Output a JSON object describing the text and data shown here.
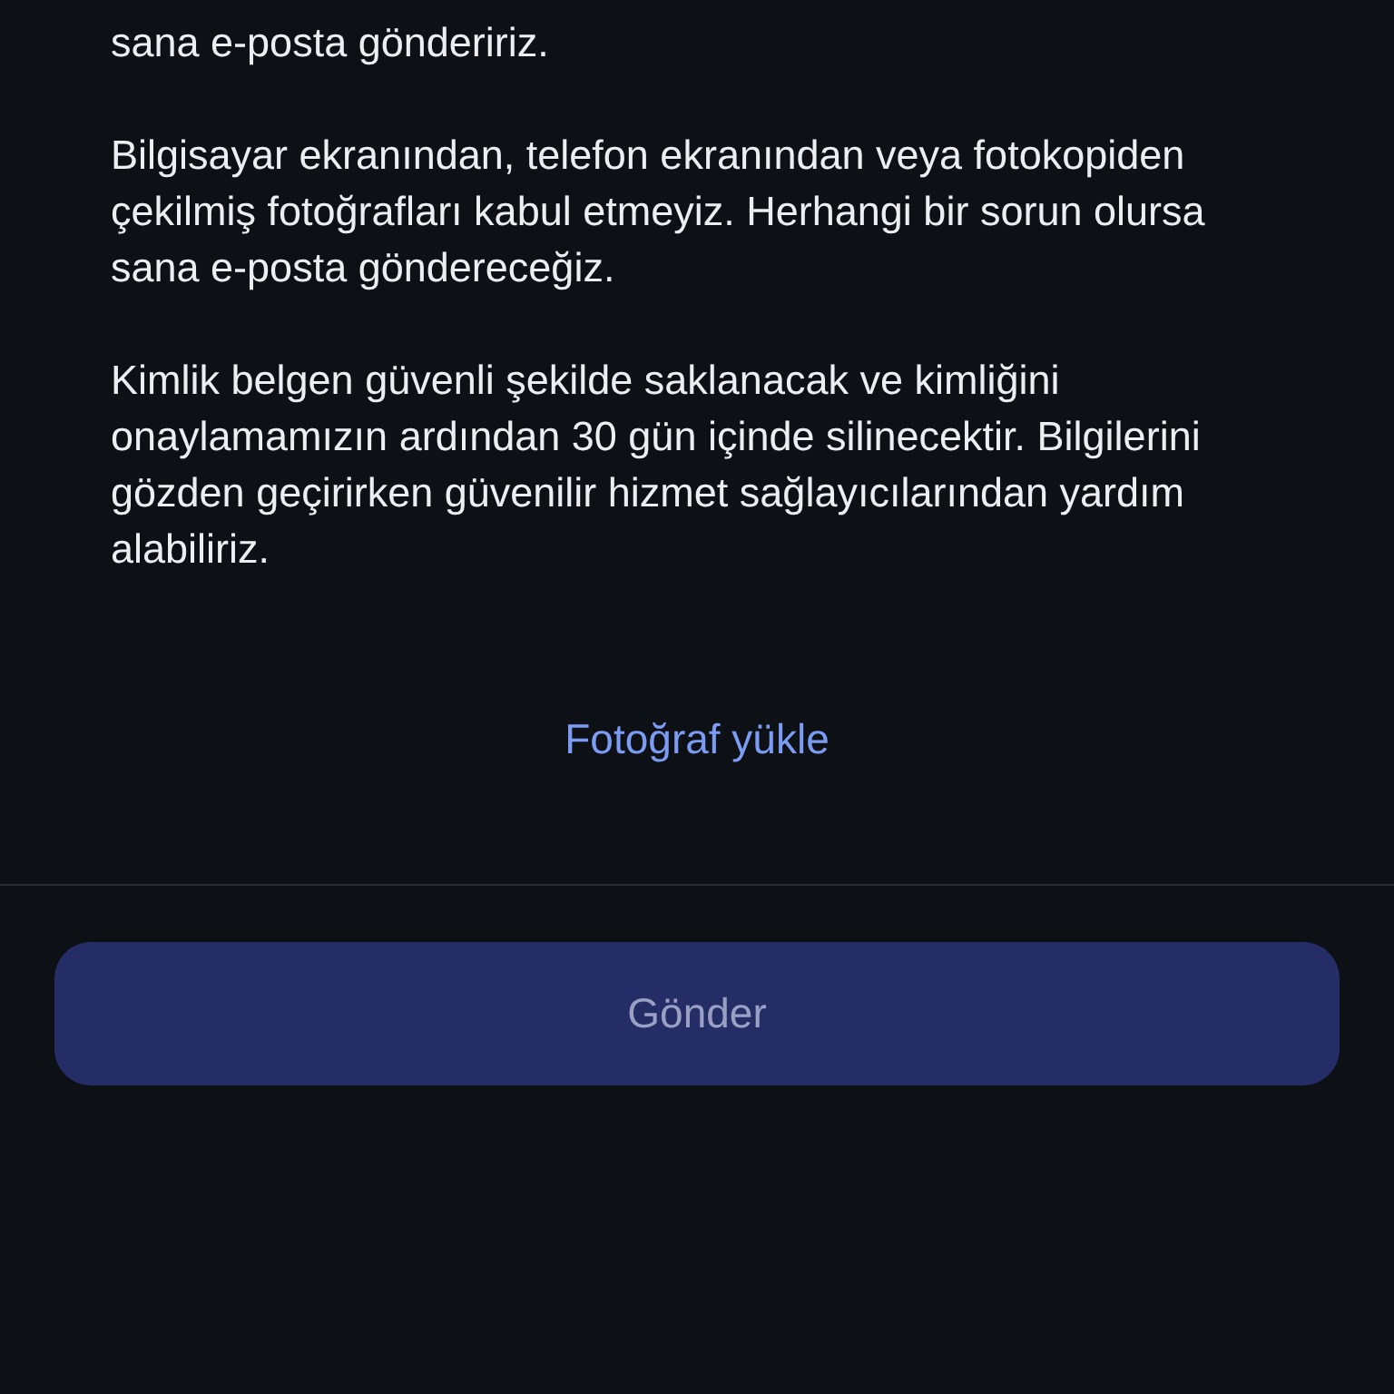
{
  "paragraphs": [
    "sana e-posta göndeririz.",
    "Bilgisayar ekranından, telefon ekranından veya fotokopiden çekilmiş fotoğrafları kabul etmeyiz. Herhangi bir sorun olursa sana e-posta göndereceğiz.",
    "Kimlik belgen güvenli şekilde saklanacak ve kimliğini onaylamamızın ardından 30 gün içinde silinecektir. Bilgilerini gözden geçirirken güvenilir hizmet sağlayıcılarından yardım alabiliriz."
  ],
  "upload_link": "Fotoğraf yükle",
  "submit_button": {
    "label": "Gönder",
    "disabled": true
  }
}
